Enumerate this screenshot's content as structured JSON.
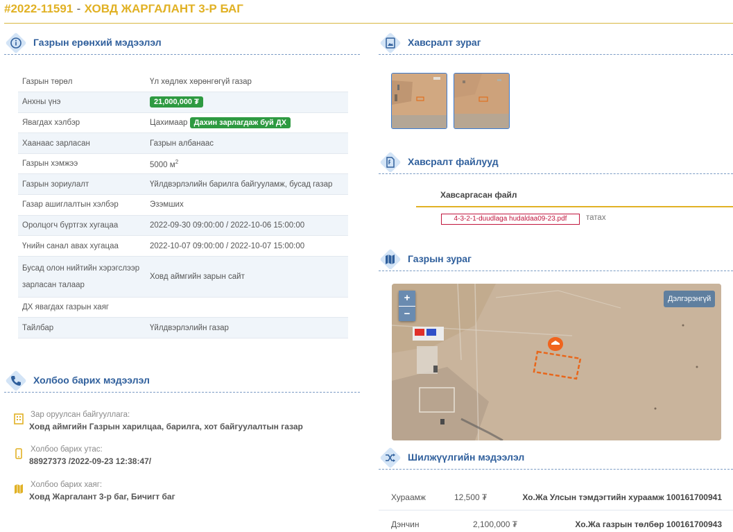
{
  "header": {
    "number": "#2022-11591",
    "dash": "-",
    "title": "ХОВД ЖАРГАЛАНТ 3-Р БАГ"
  },
  "general": {
    "title": "Газрын ерөнхий мэдээлэл",
    "rows": [
      {
        "key": "Газрын төрөл",
        "value": "Үл хөдлөх хөрөнгөгүй газар"
      },
      {
        "key": "Анхны үнэ",
        "value": "",
        "badge": "21,000,000 ₮"
      },
      {
        "key": "Явагдах хэлбэр",
        "value": "Цахимаар",
        "badge": "Дахин зарлагдаж буй ДХ"
      },
      {
        "key": "Хаанаас зарласан",
        "value": "Газрын албанаас"
      },
      {
        "key": "Газрын хэмжээ",
        "value": "5000 м",
        "sup": "2"
      },
      {
        "key": "Газрын зориулалт",
        "value": "Үйлдвэрлэлийн барилга байгууламж, бусад газар"
      },
      {
        "key": "Газар ашиглалтын хэлбэр",
        "value": "Эзэмших"
      },
      {
        "key": "Оролцогч бүртгэх хугацаа",
        "value": "2022-09-30 09:00:00 / 2022-10-06 15:00:00"
      },
      {
        "key": "Үнийн санал авах хугацаа",
        "value": "2022-10-07 09:00:00 / 2022-10-07 15:00:00"
      },
      {
        "key": "Бусад олон нийтийн хэрэгслээр зарласан талаар",
        "value": "Ховд аймгийн зарын сайт"
      },
      {
        "key": "ДХ явагдах газрын хаяг",
        "value": ""
      },
      {
        "key": "Тайлбар",
        "value": "Үйлдвэрлэлийн газар"
      }
    ]
  },
  "contact": {
    "title": "Холбоо барих мэдээлэл",
    "org_label": "Зар оруулсан байгууллага:",
    "org_value": "Ховд аймгийн Газрын харилцаа, барилга, хот байгуулалтын газар",
    "phone_label": "Холбоо барих утас:",
    "phone_value": "88927373 /2022-09-23 12:38:47/",
    "addr_label": "Холбоо барих хаяг:",
    "addr_value": "Ховд Жаргалант 3-р баг, Бичигт баг"
  },
  "photos": {
    "title": "Хавсралт зураг"
  },
  "files": {
    "title": "Хавсралт файлууд",
    "column": "Хавсаргасан файл",
    "file_name": "4-3-2-1-duudlaga hudaldaa09-23.pdf",
    "download": "татах"
  },
  "map": {
    "title": "Газрын зураг",
    "zoom_in": "+",
    "zoom_out": "−",
    "fullscreen": "Дэлгэрэнгүй"
  },
  "transfer": {
    "title": "Шилжүүлгийн мэдээлэл",
    "rows": [
      {
        "name": "Хураамж",
        "amount": "12,500 ₮",
        "desc": "Хо.Жа Улсын тэмдэгтийн хураамж 100161700941"
      },
      {
        "name": "Дэнчин",
        "amount": "2,100,000 ₮",
        "desc": "Хо.Жа газрын төлбөр 100161700943"
      }
    ]
  },
  "colors": {
    "accent": "#e1b124",
    "heading": "#2f5f9c",
    "badge": "#2e9a41",
    "file_link": "#c0143c"
  }
}
